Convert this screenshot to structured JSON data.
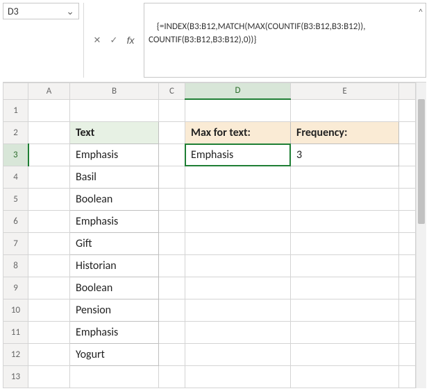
{
  "namebox": {
    "value": "D3"
  },
  "formula_bar": {
    "line1": "{=INDEX(B3:B12,MATCH(MAX(COUNTIF(B3:B12,B3:B12)),",
    "line2": "COUNTIF(B3:B12,B3:B12),0))}"
  },
  "column_headers": {
    "A": "A",
    "B": "B",
    "C": "C",
    "D": "D",
    "E": "E"
  },
  "row_headers": [
    "1",
    "2",
    "3",
    "4",
    "5",
    "6",
    "7",
    "8",
    "9",
    "10",
    "11",
    "12",
    "13"
  ],
  "active_cell": "D3",
  "headers": {
    "text": "Text",
    "max_for_text": "Max for text:",
    "frequency": "Frequency:"
  },
  "text_values": [
    "Emphasis",
    "Basil",
    "Boolean",
    "Emphasis",
    "Gift",
    "Historian",
    "Boolean",
    "Pension",
    "Emphasis",
    "Yogurt"
  ],
  "result": {
    "max_text": "Emphasis",
    "frequency": "3"
  },
  "icons": {
    "cancel": "✕",
    "confirm": "✓",
    "fx": "fx",
    "dropdown": "⌄",
    "expand": "^"
  }
}
